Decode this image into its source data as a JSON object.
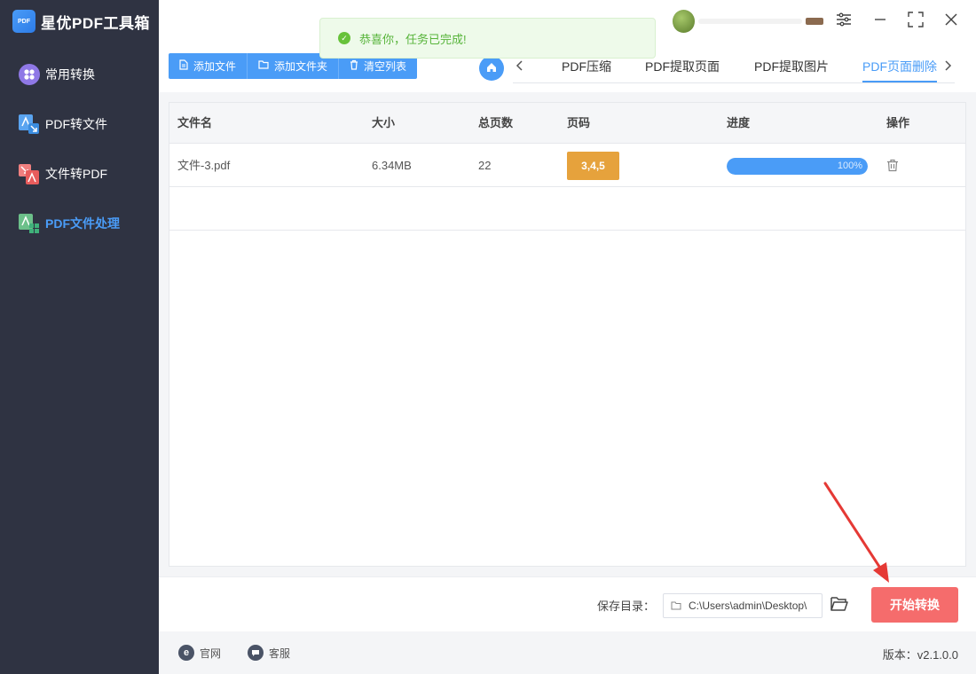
{
  "app": {
    "title": "星优PDF工具箱",
    "logo_text": "PDF"
  },
  "sidebar": {
    "items": [
      {
        "label": "常用转换",
        "icon": "grid-icon"
      },
      {
        "label": "PDF转文件",
        "icon": "pdf-to-file-icon"
      },
      {
        "label": "文件转PDF",
        "icon": "file-to-pdf-icon"
      },
      {
        "label": "PDF文件处理",
        "icon": "pdf-process-icon",
        "active": true
      }
    ]
  },
  "toast": {
    "message": "恭喜你，任务已完成!"
  },
  "toolbar": {
    "add_file": "添加文件",
    "add_folder": "添加文件夹",
    "clear_list": "清空列表"
  },
  "tabs": [
    {
      "label": "PDF压缩"
    },
    {
      "label": "PDF提取页面"
    },
    {
      "label": "PDF提取图片"
    },
    {
      "label": "PDF页面删除",
      "active": true
    }
  ],
  "table": {
    "headers": {
      "name": "文件名",
      "size": "大小",
      "pages": "总页数",
      "page_codes": "页码",
      "progress": "进度",
      "action": "操作"
    },
    "rows": [
      {
        "name": "文件-3.pdf",
        "size": "6.34MB",
        "pages": "22",
        "page_codes": "3,4,5",
        "progress": 1.0,
        "progress_label": "100%"
      }
    ]
  },
  "bottom": {
    "save_label": "保存目录：",
    "save_path": "C:\\Users\\admin\\Desktop\\",
    "start_label": "开始转换"
  },
  "footer": {
    "website": "官网",
    "support": "客服",
    "version": "版本：v2.1.0.0"
  },
  "colors": {
    "sidebar_bg": "#2f3342",
    "accent": "#4a9cf7",
    "danger": "#f56c6c",
    "warning": "#e6a23c",
    "success": "#67c23a"
  }
}
